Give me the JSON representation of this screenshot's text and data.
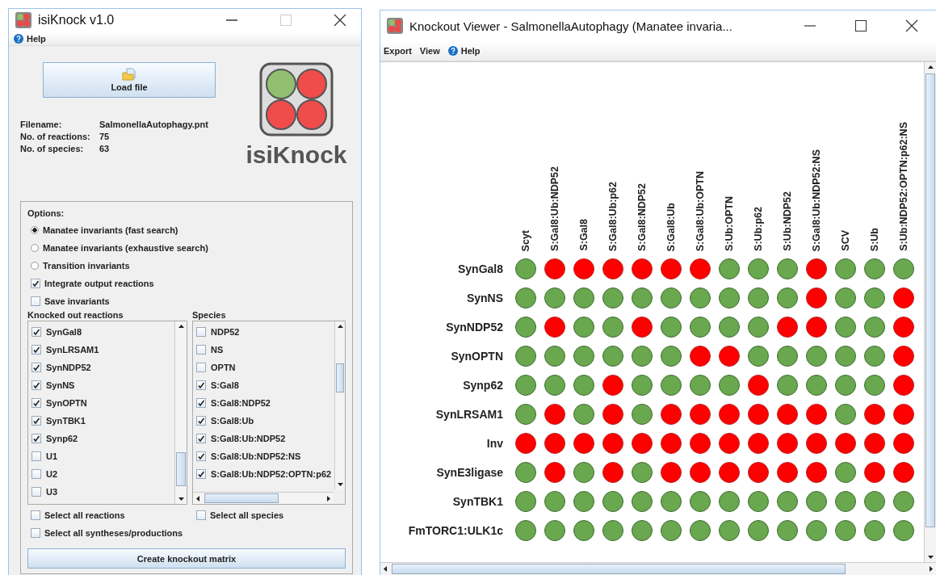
{
  "main_window": {
    "title": "isiKnock v1.0",
    "menu": [
      {
        "label": "Help",
        "has_icon": true
      }
    ],
    "load_button": "Load file",
    "logo_text": "isiKnock",
    "info": [
      {
        "label": "Filename:",
        "value": "SalmonellaAutophagy.pnt"
      },
      {
        "label": "No. of reactions:",
        "value": "75"
      },
      {
        "label": "No. of species:",
        "value": "63"
      }
    ],
    "options": {
      "heading": "Options:",
      "items": [
        {
          "kind": "radio",
          "label": "Manatee invariants (fast search)",
          "selected": true
        },
        {
          "kind": "radio",
          "label": "Manatee invariants (exhaustive search)",
          "selected": false
        },
        {
          "kind": "radio",
          "label": "Transition invariants",
          "selected": false
        },
        {
          "kind": "checkbox",
          "label": "Integrate output reactions",
          "checked": true
        },
        {
          "kind": "checkbox",
          "label": "Save invariants",
          "checked": false
        }
      ]
    },
    "reactions": {
      "heading": "Knocked out reactions",
      "items": [
        {
          "label": "SynGal8",
          "checked": true
        },
        {
          "label": "SynLRSAM1",
          "checked": true
        },
        {
          "label": "SynNDP52",
          "checked": true
        },
        {
          "label": "SynNS",
          "checked": true
        },
        {
          "label": "SynOPTN",
          "checked": true
        },
        {
          "label": "SynTBK1",
          "checked": true
        },
        {
          "label": "Synp62",
          "checked": true
        },
        {
          "label": "U1",
          "checked": false
        },
        {
          "label": "U2",
          "checked": false
        },
        {
          "label": "U3",
          "checked": false
        }
      ]
    },
    "species": {
      "heading": "Species",
      "items": [
        {
          "label": "NDP52",
          "checked": false
        },
        {
          "label": "NS",
          "checked": false
        },
        {
          "label": "OPTN",
          "checked": false
        },
        {
          "label": "S:Gal8",
          "checked": true
        },
        {
          "label": "S:Gal8:NDP52",
          "checked": true
        },
        {
          "label": "S:Gal8:Ub",
          "checked": true
        },
        {
          "label": "S:Gal8:Ub:NDP52",
          "checked": true
        },
        {
          "label": "S:Gal8:Ub:NDP52:NS",
          "checked": true
        },
        {
          "label": "S:Gal8:Ub:NDP52:OPTN:p62",
          "checked": true
        }
      ]
    },
    "select_all": [
      {
        "label": "Select all reactions",
        "checked": false
      },
      {
        "label": "Select all species",
        "checked": false
      },
      {
        "label": "Select all syntheses/productions",
        "checked": false
      }
    ],
    "create_button": "Create knockout matrix"
  },
  "viewer_window": {
    "title": "Knockout Viewer - SalmonellaAutophagy (Manatee invaria...",
    "menu": [
      {
        "label": "Export",
        "has_icon": false
      },
      {
        "label": "View",
        "has_icon": false
      },
      {
        "label": "Help",
        "has_icon": true
      }
    ],
    "columns": [
      "Scyt",
      "S:Gal8:Ub:NDP52",
      "S:Gal8",
      "S:Gal8:Ub:p62",
      "S:Gal8:NDP52",
      "S:Gal8:Ub",
      "S:Gal8:Ub:OPTN",
      "S:Ub:OPTN",
      "S:Ub:p62",
      "S:Ub:NDP52",
      "S:Gal8:Ub:NDP52:NS",
      "SCV",
      "S:Ub",
      "S:Ub:NDP52:OPTN:p62:NS"
    ],
    "rows": [
      {
        "label": "SynGal8",
        "knocked": [
          false,
          true,
          true,
          true,
          true,
          true,
          true,
          false,
          false,
          false,
          true,
          false,
          false,
          false
        ]
      },
      {
        "label": "SynNS",
        "knocked": [
          false,
          false,
          false,
          false,
          false,
          false,
          false,
          false,
          false,
          false,
          true,
          false,
          false,
          true
        ]
      },
      {
        "label": "SynNDP52",
        "knocked": [
          false,
          true,
          false,
          false,
          true,
          false,
          false,
          false,
          false,
          true,
          true,
          false,
          false,
          true
        ]
      },
      {
        "label": "SynOPTN",
        "knocked": [
          false,
          false,
          false,
          false,
          false,
          false,
          true,
          true,
          false,
          false,
          false,
          false,
          false,
          true
        ]
      },
      {
        "label": "Synp62",
        "knocked": [
          false,
          false,
          false,
          true,
          false,
          false,
          false,
          false,
          true,
          false,
          false,
          false,
          false,
          true
        ]
      },
      {
        "label": "SynLRSAM1",
        "knocked": [
          false,
          true,
          false,
          true,
          false,
          true,
          true,
          true,
          true,
          true,
          true,
          false,
          true,
          true
        ]
      },
      {
        "label": "Inv",
        "knocked": [
          true,
          true,
          true,
          true,
          true,
          true,
          true,
          true,
          true,
          true,
          true,
          true,
          true,
          true
        ]
      },
      {
        "label": "SynE3ligase",
        "knocked": [
          false,
          true,
          false,
          true,
          false,
          true,
          true,
          true,
          true,
          true,
          true,
          false,
          true,
          true
        ]
      },
      {
        "label": "SynTBK1",
        "knocked": [
          false,
          false,
          false,
          false,
          false,
          false,
          false,
          false,
          false,
          false,
          false,
          false,
          false,
          false
        ]
      },
      {
        "label": "FmTORC1:ULK1c",
        "knocked": [
          false,
          false,
          false,
          false,
          false,
          false,
          false,
          false,
          false,
          false,
          false,
          false,
          false,
          false
        ]
      }
    ]
  }
}
